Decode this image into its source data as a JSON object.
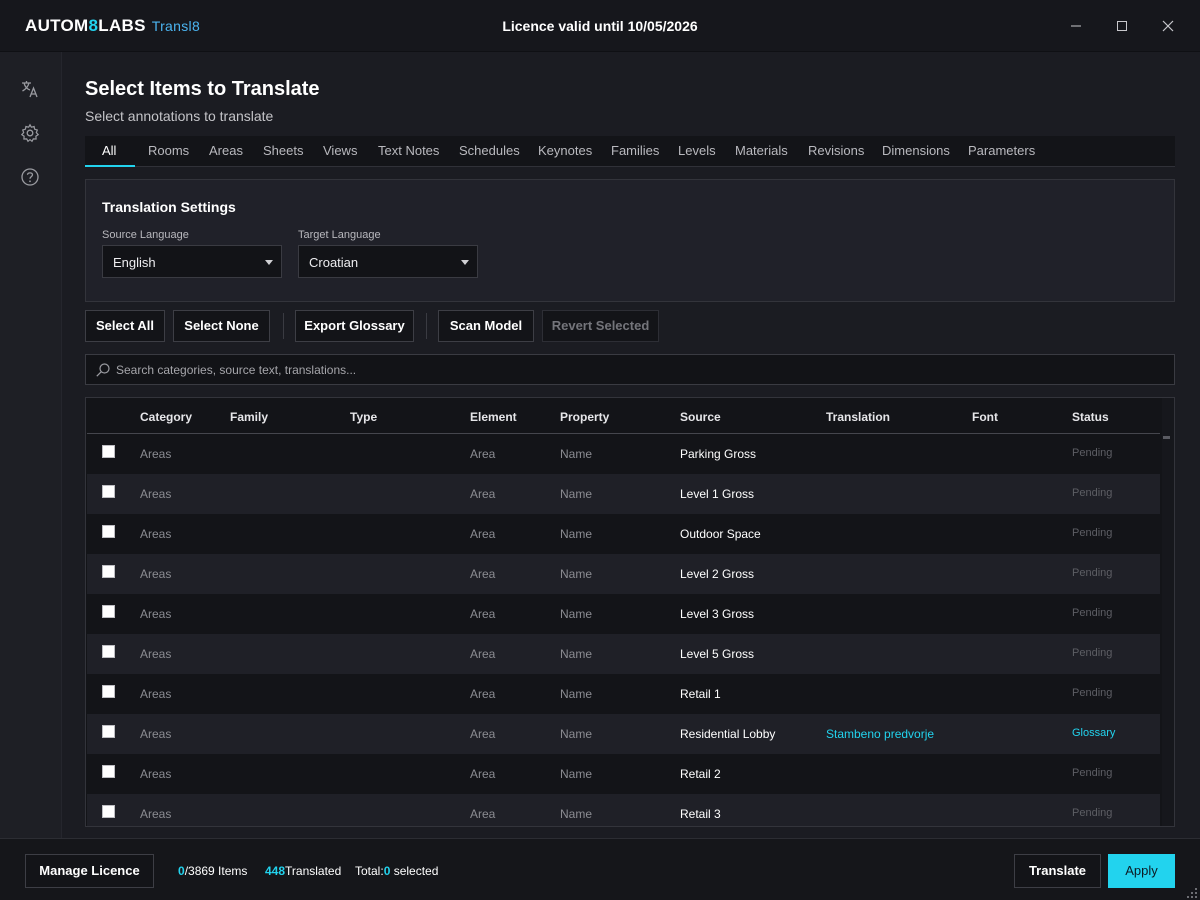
{
  "app": {
    "logo_part1": "AUTOM",
    "logo_part2": "8",
    "logo_part3": "LABS",
    "product": "Transl8",
    "licence_text": "Licence valid until 10/05/2026"
  },
  "window_controls": {
    "minimize_icon": "minimize-icon",
    "maximize_icon": "maximize-icon",
    "close_icon": "close-icon"
  },
  "sidebar": {
    "items": [
      {
        "icon": "translate-icon"
      },
      {
        "icon": "gear-icon"
      },
      {
        "icon": "help-icon"
      }
    ]
  },
  "page": {
    "title": "Select Items to Translate",
    "subtitle": "Select annotations to translate"
  },
  "tabs": [
    {
      "label": "All",
      "active": true
    },
    {
      "label": "Rooms"
    },
    {
      "label": "Areas"
    },
    {
      "label": "Sheets"
    },
    {
      "label": "Views"
    },
    {
      "label": "Text Notes"
    },
    {
      "label": "Schedules"
    },
    {
      "label": "Keynotes"
    },
    {
      "label": "Families"
    },
    {
      "label": "Levels"
    },
    {
      "label": "Materials"
    },
    {
      "label": "Revisions"
    },
    {
      "label": "Dimensions"
    },
    {
      "label": "Parameters"
    }
  ],
  "settings": {
    "title": "Translation Settings",
    "source_label": "Source Language",
    "source_value": "English",
    "target_label": "Target Language",
    "target_value": "Croatian"
  },
  "toolbar": {
    "select_all": "Select All",
    "select_none": "Select None",
    "export_glossary": "Export Glossary",
    "scan_model": "Scan Model",
    "revert_selected": "Revert Selected"
  },
  "search": {
    "placeholder": "Search categories, source text, translations..."
  },
  "table": {
    "headers": {
      "category": "Category",
      "family": "Family",
      "type": "Type",
      "element": "Element",
      "property": "Property",
      "source": "Source",
      "translation": "Translation",
      "font": "Font",
      "status": "Status"
    },
    "rows": [
      {
        "category": "Areas",
        "family": "",
        "type": "",
        "element": "Area",
        "property": "Name",
        "source": "Parking Gross",
        "translation": "",
        "font": "",
        "status": "Pending"
      },
      {
        "category": "Areas",
        "family": "",
        "type": "",
        "element": "Area",
        "property": "Name",
        "source": "Level 1 Gross",
        "translation": "",
        "font": "",
        "status": "Pending"
      },
      {
        "category": "Areas",
        "family": "",
        "type": "",
        "element": "Area",
        "property": "Name",
        "source": "Outdoor Space",
        "translation": "",
        "font": "",
        "status": "Pending"
      },
      {
        "category": "Areas",
        "family": "",
        "type": "",
        "element": "Area",
        "property": "Name",
        "source": "Level 2 Gross",
        "translation": "",
        "font": "",
        "status": "Pending"
      },
      {
        "category": "Areas",
        "family": "",
        "type": "",
        "element": "Area",
        "property": "Name",
        "source": "Level 3 Gross",
        "translation": "",
        "font": "",
        "status": "Pending"
      },
      {
        "category": "Areas",
        "family": "",
        "type": "",
        "element": "Area",
        "property": "Name",
        "source": "Level 5 Gross",
        "translation": "",
        "font": "",
        "status": "Pending"
      },
      {
        "category": "Areas",
        "family": "",
        "type": "",
        "element": "Area",
        "property": "Name",
        "source": "Retail 1",
        "translation": "",
        "font": "",
        "status": "Pending"
      },
      {
        "category": "Areas",
        "family": "",
        "type": "",
        "element": "Area",
        "property": "Name",
        "source": "Residential Lobby",
        "translation": "Stambeno predvorje",
        "font": "",
        "status": "Glossary"
      },
      {
        "category": "Areas",
        "family": "",
        "type": "",
        "element": "Area",
        "property": "Name",
        "source": "Retail 2",
        "translation": "",
        "font": "",
        "status": "Pending"
      },
      {
        "category": "Areas",
        "family": "",
        "type": "",
        "element": "Area",
        "property": "Name",
        "source": "Retail 3",
        "translation": "",
        "font": "",
        "status": "Pending"
      }
    ]
  },
  "footer": {
    "manage_licence": "Manage Licence",
    "selected_count": "0",
    "total_items": "/3869 Items",
    "translated_count": "448",
    "translated_label": "Translated",
    "total_label": "Total:",
    "total_selected_count": "0",
    "total_selected_label": " selected",
    "translate": "Translate",
    "apply": "Apply"
  },
  "colors": {
    "accent": "#22d3ee",
    "background": "#1b1c22",
    "panel": "#131418"
  }
}
